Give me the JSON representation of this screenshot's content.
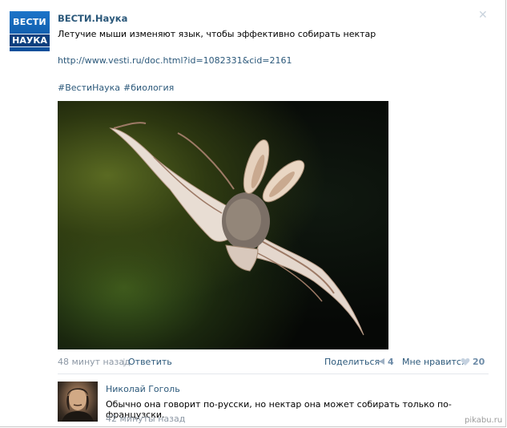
{
  "post": {
    "author": "ВЕСТИ.Наука",
    "avatar_line1": "ВЕСТИ",
    "avatar_line2": "НАУКА",
    "text": "Летучие мыши изменяют язык, чтобы эффективно собирать нектар",
    "link": "http://www.vesti.ru/doc.html?id=1082331&cid=2161",
    "tags": [
      "#ВестиНаука",
      "#биология"
    ],
    "close_icon": "✕",
    "time": "48 минут назад",
    "separator": "|",
    "reply_label": "Ответить",
    "share_label": "Поделиться",
    "share_count": "4",
    "like_label": "Мне нравится",
    "like_count": "20"
  },
  "comment": {
    "author": "Николай Гоголь",
    "text": "Обычно она говорит по-русски, но нектар она может собирать только по-французски.",
    "time": "42 минуты назад"
  },
  "watermark": "pikabu.ru",
  "colors": {
    "link": "#2b587a",
    "muted": "#8c97a4",
    "counter": "#6e8ca8",
    "brand_blue": "#0c3f7e"
  },
  "icons": {
    "share": "megaphone-icon",
    "like": "heart-icon",
    "close": "close-icon"
  }
}
